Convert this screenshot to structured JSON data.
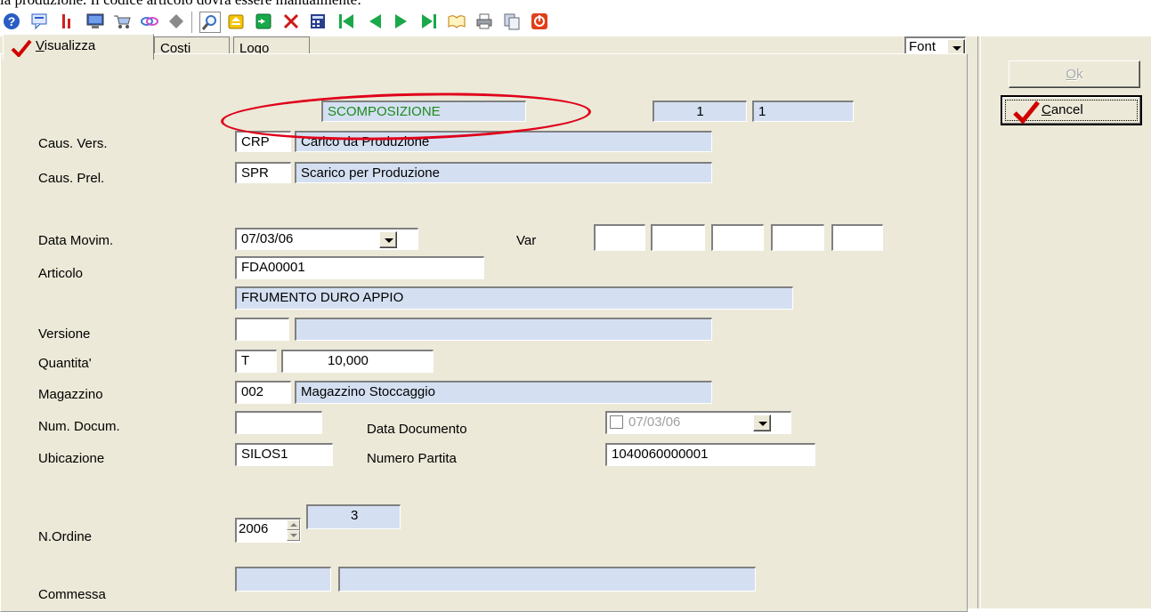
{
  "caption": "la produzione. Il codice articolo dovrà essere manualmente:",
  "toolbar": {
    "icons": [
      "help-icon",
      "chat-icon",
      "info-icon",
      "monitor-icon",
      "cart-icon",
      "link-icon",
      "diamond-icon",
      "search-icon",
      "open-folder-icon",
      "export-icon",
      "delete-icon",
      "calculator-icon",
      "first-record-icon",
      "prev-record-icon",
      "next-record-icon",
      "last-record-icon",
      "book-icon",
      "print-icon",
      "copy-icon",
      "exit-icon"
    ]
  },
  "tabs": [
    {
      "label": "Visualizza",
      "underline": "V",
      "rest": "isualizza"
    },
    {
      "label": "Costi",
      "underline": "C",
      "rest": "osti"
    },
    {
      "label": "Logo",
      "underline": "L",
      "rest": "ogo"
    }
  ],
  "font_select": "Font",
  "buttons": {
    "ok": "Ok",
    "ok_u": "O",
    "ok_rest": "k",
    "cancel": "Cancel",
    "cancel_u": "C",
    "cancel_rest": "ancel"
  },
  "header": {
    "title": "SCOMPOSIZIONE",
    "num1": "1",
    "num2": "1"
  },
  "labels": {
    "caus_vers": "Caus. Vers.",
    "caus_prel": "Caus. Prel.",
    "data_movim": "Data Movim.",
    "var": "Var",
    "articolo": "Articolo",
    "versione": "Versione",
    "quantita": "Quantita'",
    "magazzino": "Magazzino",
    "num_docum": "Num. Docum.",
    "data_documento": "Data Documento",
    "ubicazione": "Ubicazione",
    "numero_partita": "Numero Partita",
    "n_ordine": "N.Ordine",
    "commessa": "Commessa"
  },
  "values": {
    "caus_vers_code": "CRP",
    "caus_vers_desc": "Carico da Produzione",
    "caus_prel_code": "SPR",
    "caus_prel_desc": "Scarico per Produzione",
    "data_movim": "07/03/06",
    "articolo_code": "FDA00001",
    "articolo_desc": "FRUMENTO DURO APPIO",
    "versione_code": "",
    "versione_desc": "",
    "quantita_um": "T",
    "quantita_val": "10,000",
    "magazzino_code": "002",
    "magazzino_desc": "Magazzino Stoccaggio",
    "num_docum": "",
    "data_documento": "07/03/06",
    "ubicazione": "SILOS1",
    "numero_partita": "1040060000001",
    "n_ordine_anno": "2006",
    "n_ordine_num": "3",
    "commessa_code": "",
    "commessa_desc": ""
  },
  "colors": {
    "highlight_ellipse": "#e0001a",
    "title_text": "#1e8a1e",
    "field_blue": "#d4e0f2",
    "window_bg": "#ece9d8"
  }
}
